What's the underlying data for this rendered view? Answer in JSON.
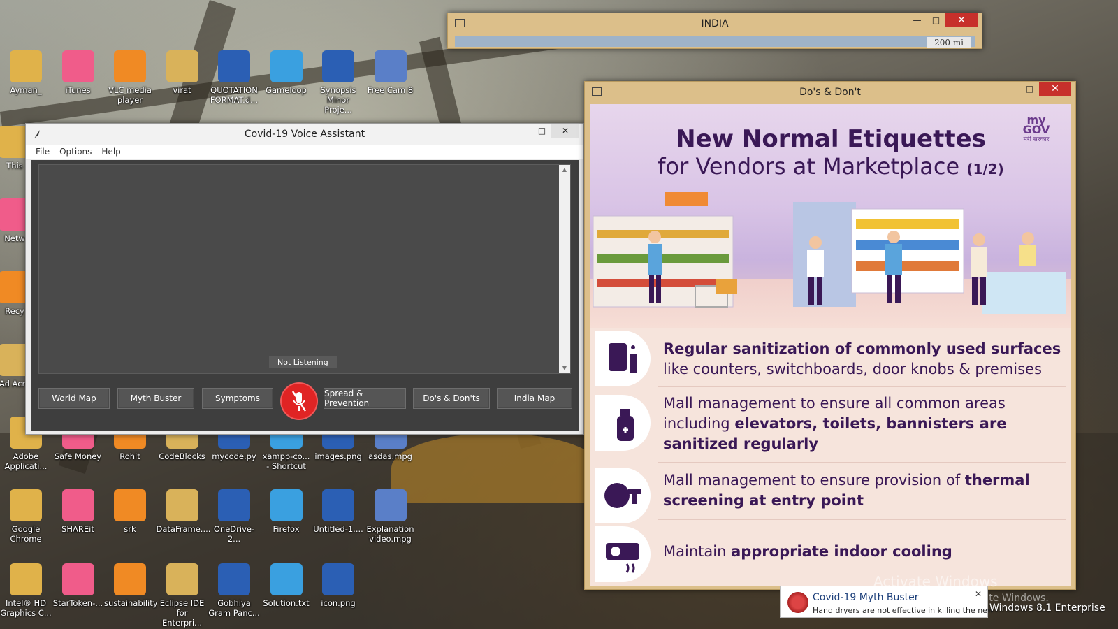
{
  "desktop": {
    "icons_row_top": [
      "Ayman_",
      "iTunes",
      "VLC media player",
      "virat",
      "QUOTATION FORMAT.d...",
      "Gameloop",
      "Synopsis Minor Proje...",
      "Free Cam 8"
    ],
    "icons_left_col": [
      "This",
      "Netw",
      "Recy",
      "Ad Acro"
    ],
    "icons_row_mid": [
      "Adobe Applicati...",
      "Safe Money",
      "Rohit",
      "CodeBlocks",
      "mycode.py",
      "xampp-co... - Shortcut",
      "images.png",
      "asdas.mpg"
    ],
    "icons_row_4": [
      "Google Chrome",
      "SHAREit",
      "srk",
      "DataFrame....",
      "OneDrive-2...",
      "Firefox",
      "Untitled-1....",
      "Explanation video.mpg"
    ],
    "icons_row_5": [
      "Intel® HD Graphics C...",
      "StarToken-...",
      "sustainability",
      "Eclipse IDE for Enterpri...",
      "Gobhiya Gram Panc...",
      "Solution.txt",
      "icon.png"
    ]
  },
  "voice_assistant": {
    "title": "Covid-19 Voice Assistant",
    "menu": [
      "File",
      "Options",
      "Help"
    ],
    "status": "Not Listening",
    "buttons": {
      "world_map": "World Map",
      "myth_buster": "Myth Buster",
      "symptoms": "Symptoms",
      "spread_prevention": "Spread & Prevention",
      "dos_donts": "Do's & Don'ts",
      "india_map": "India Map"
    }
  },
  "india_window": {
    "title": "INDIA",
    "scale": "200 mi"
  },
  "dos_window": {
    "title": "Do's & Don't",
    "poster": {
      "heading": "New Normal Etiquettes",
      "subheading": "for Vendors at Marketplace",
      "page": "(1/2)",
      "logo_top": "my",
      "logo_main": "GOV",
      "logo_sub": "मेरी सरकार",
      "tips": [
        {
          "bold": "Regular sanitization of commonly used surfaces",
          "rest": " like counters, switchboards, door knobs & premises"
        },
        {
          "pre": "Mall management to ensure all common areas including ",
          "bold": "elevators, toilets, bannisters are sanitized regularly"
        },
        {
          "pre": "Mall management to ensure provision of ",
          "bold": "thermal screening at entry point"
        },
        {
          "pre": "Maintain ",
          "bold": "appropriate indoor cooling"
        }
      ]
    }
  },
  "notification": {
    "title": "Covid-19 Myth Buster",
    "body": "Hand dryers are not effective in killing the new",
    "close": "✕"
  },
  "watermark": {
    "line1": "Activate Windows",
    "line2": "Go to Settings to activate Windows."
  },
  "os_edition": "Windows 8.1 Enterprise",
  "colors": {
    "poster_purple": "#3a1856",
    "mic_red": "#e02424",
    "close_red": "#c7302b",
    "window_tan": "#dcbf8a"
  }
}
